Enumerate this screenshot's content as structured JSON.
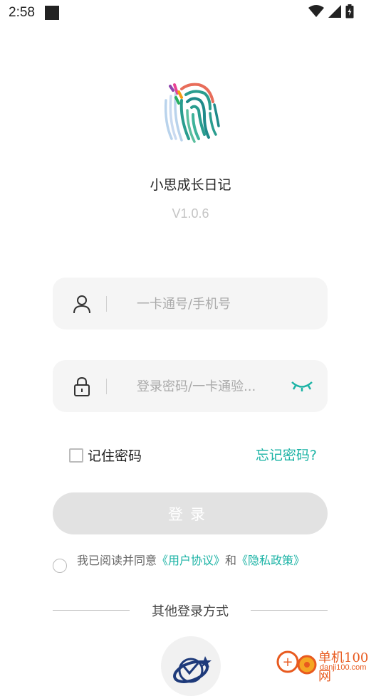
{
  "status_bar": {
    "time": "2:58"
  },
  "app": {
    "name": "小思成长日记",
    "version": "V1.0.6"
  },
  "login_form": {
    "account_placeholder": "一卡通号/手机号",
    "password_placeholder": "登录密码/一卡通验..."
  },
  "options": {
    "remember_label": "记住密码",
    "forgot_label": "忘记密码?"
  },
  "login_button": {
    "label": "登录"
  },
  "agreement": {
    "prefix": "我已阅读并同意",
    "user_agreement": "《用户协议》",
    "conjunction": "和",
    "privacy_policy": "《隐私政策》"
  },
  "other_login": {
    "label": "其他登录方式"
  },
  "watermark": {
    "text": "单机100网",
    "url": "danji100.com"
  },
  "colors": {
    "accent": "#1bb3a5",
    "input_bg": "#f5f5f5",
    "button_disabled": "#e2e2e2",
    "version_text": "#c4c4c4"
  }
}
